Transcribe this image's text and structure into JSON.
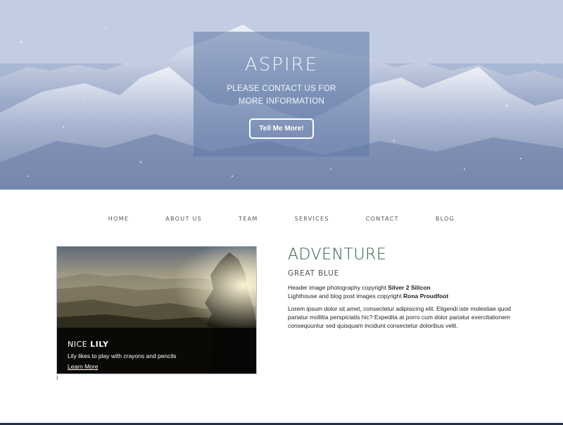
{
  "hero": {
    "title": "ASPIRE",
    "subtitle_line1": "PLEASE CONTACT US FOR",
    "subtitle_line2": "MORE INFORMATION",
    "button_label": "Tell Me More!"
  },
  "nav": {
    "items": [
      {
        "label": "HOME"
      },
      {
        "label": "ABOUT US"
      },
      {
        "label": "TEAM"
      },
      {
        "label": "SERVICES"
      },
      {
        "label": "CONTACT"
      },
      {
        "label": "BLOG"
      }
    ]
  },
  "card": {
    "title_prefix": "NICE ",
    "title_bold": "LILY",
    "text": "Lily likes to play with crayons and pencils",
    "link_label": "Learn More"
  },
  "stray_text": "f",
  "article": {
    "title": "ADVENTURE",
    "subtitle": "GREAT BLUE",
    "credit1_prefix": "Header image photography copyright ",
    "credit1_name": "Silver 2 Silicon",
    "credit2_prefix": "Lighthouse and blog post images copyright ",
    "credit2_name": "Rona Proudfoot",
    "body": "Lorem ipsum dolor sit amet, consectetur adipisicing elit. Eligendi iste molestiae quod pariatur mollitia perspiciatis hic? Expedita at porro cum dolor pariatur exercitationem consequuntur sed quisquam incidunt consectetur doloribus velit."
  },
  "colors": {
    "accent_green": "#2e5e42",
    "hero_overlay": "#5f78a5"
  }
}
